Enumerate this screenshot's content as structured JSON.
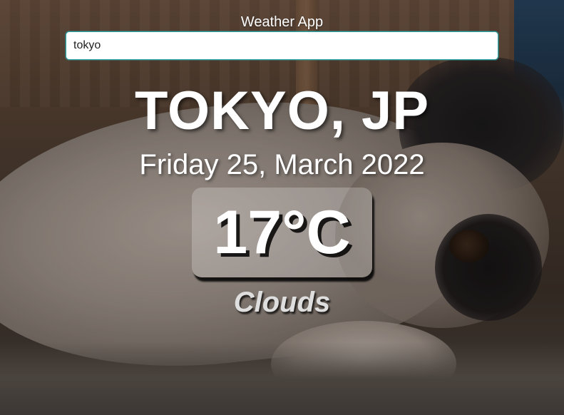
{
  "app": {
    "title": "Weather App"
  },
  "search": {
    "value": "tokyo",
    "border_color": "#2fa4a4"
  },
  "location": {
    "label": "TOKYO, JP"
  },
  "date": {
    "label": "Friday 25, March 2022"
  },
  "weather": {
    "temperature": "17°C",
    "condition": "Clouds"
  },
  "background": {
    "subject": "cat-photo"
  }
}
